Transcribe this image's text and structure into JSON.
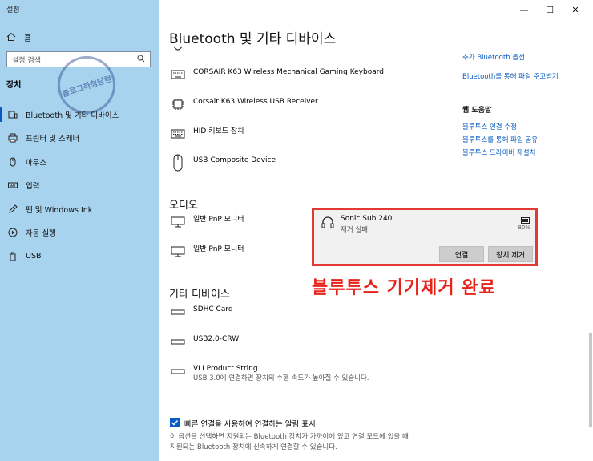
{
  "window": {
    "title": "설정",
    "minimize": "—",
    "maximize": "☐",
    "close": "✕"
  },
  "sidebar": {
    "home": "홈",
    "search_placeholder": "설정 검색",
    "section": "장치",
    "stamp": "블로그하청당컴",
    "items": [
      {
        "label": "Bluetooth 및 기타 디바이스",
        "icon": "bluetooth-devices-icon",
        "active": true
      },
      {
        "label": "프린터 및 스캐너",
        "icon": "printer-icon"
      },
      {
        "label": "마우스",
        "icon": "mouse-icon"
      },
      {
        "label": "입력",
        "icon": "keyboard-icon"
      },
      {
        "label": "펜 및 Windows Ink",
        "icon": "pen-icon"
      },
      {
        "label": "자동 실행",
        "icon": "autoplay-icon"
      },
      {
        "label": "USB",
        "icon": "usb-icon"
      }
    ]
  },
  "main": {
    "title": "Bluetooth 및 기타 디바이스",
    "devices": [
      {
        "name": "CORSAIR K63 Wireless Mechanical Gaming Keyboard"
      },
      {
        "name": "Corsair K63 Wireless USB Receiver"
      },
      {
        "name": "HID 키보드 장치"
      },
      {
        "name": "USB Composite Device"
      }
    ],
    "audio_heading": "오디오",
    "audio": [
      {
        "name": "일반 PnP 모니터"
      },
      {
        "name": "일반 PnP 모니터"
      }
    ],
    "other_heading": "기타 디바이스",
    "other": [
      {
        "name": "SDHC Card"
      },
      {
        "name": "USB2.0-CRW"
      },
      {
        "name": "VLI Product String",
        "sub": "USB 3.0에 연결하면 장치의 수행 속도가 높아질 수 있습니다."
      }
    ],
    "checkbox_label": "빠른 연결을 사용하여 연결하는 알림 표시",
    "checkbox_desc": "이 옵션을 선택하면 지원되는 Bluetooth 장치가 가까이에 있고 연결 모드에 있을 때 지원되는 Bluetooth 장치에 신속하게 연결할 수 있습니다."
  },
  "popup": {
    "device_name": "Sonic Sub 240",
    "status": "제거 실패",
    "battery": "80%",
    "connect_label": "연결",
    "remove_label": "장치 제거",
    "caption": "블루투스 기기제거 완료",
    "accent": "#e23a33"
  },
  "right": {
    "link1": "추가 Bluetooth 옵션",
    "link2": "Bluetooth를 통해 파일 주고받기",
    "help_heading": "웹 도움말",
    "help1": "블루투스 연결 수정",
    "help2": "블루투스를 통해 파일 공유",
    "help3": "블루투스 드라이버 재설치"
  }
}
